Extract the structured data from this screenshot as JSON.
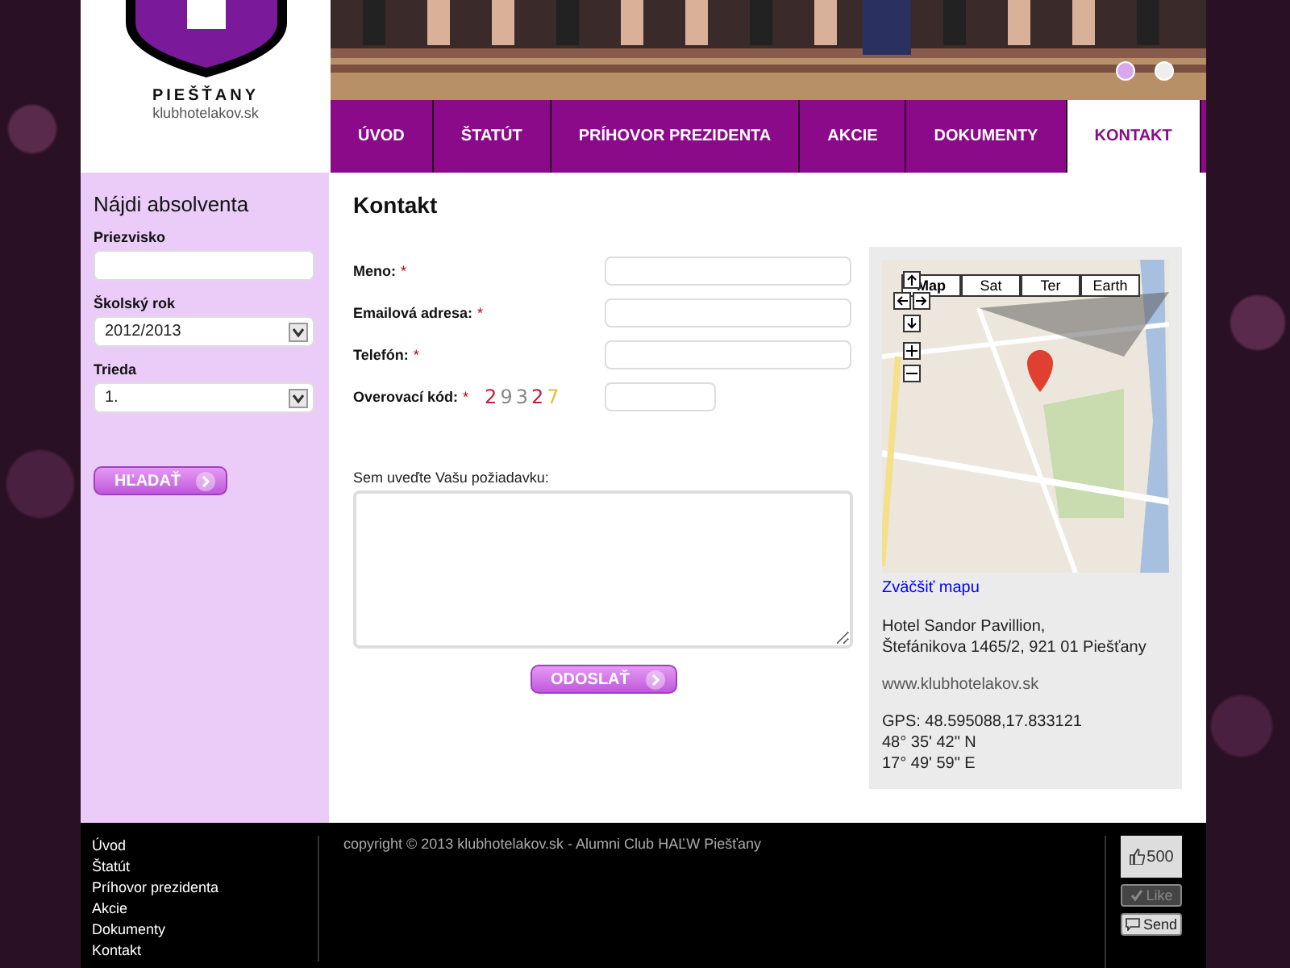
{
  "logo": {
    "city": "PIEŠŤANY",
    "site": "klubhotelakov.sk"
  },
  "banner": {
    "slides": [
      {
        "selected": true
      },
      {
        "selected": false
      }
    ]
  },
  "nav": [
    {
      "label": "ÚVOD",
      "selected": false
    },
    {
      "label": "ŠTATÚT",
      "selected": false
    },
    {
      "label": "PRÍHOVOR PREZIDENTA",
      "selected": false
    },
    {
      "label": "AKCIE",
      "selected": false
    },
    {
      "label": "DOKUMENTY",
      "selected": false
    },
    {
      "label": "KONTAKT",
      "selected": true
    }
  ],
  "sidebar": {
    "title": "Nájdi absolventa",
    "fields": [
      {
        "kind": "input",
        "label": "Priezvisko"
      },
      {
        "kind": "select",
        "label": "Školský rok",
        "value": "2012/2013"
      },
      {
        "kind": "select",
        "label": "Trieda",
        "value": "1."
      }
    ],
    "button": "HĽADAŤ"
  },
  "content": {
    "title": "Kontakt",
    "fields": [
      {
        "label": "Meno:",
        "required": "*",
        "kind": "wide"
      },
      {
        "label": "Emailová adresa:",
        "required": "*",
        "kind": "wide"
      },
      {
        "label": "Telefón:",
        "required": "*",
        "kind": "wide"
      },
      {
        "label": "Overovací kód:",
        "required": "*",
        "kind": "captcha",
        "captcha": "29327"
      }
    ],
    "message_label": "Sem uveďte Vašu požiadavku:",
    "submit": "ODOSLAŤ"
  },
  "map": {
    "map_types": [
      {
        "label": "Map",
        "selected": true
      },
      {
        "label": "Sat",
        "selected": false
      },
      {
        "label": "Ter",
        "selected": false
      },
      {
        "label": "Earth",
        "selected": false
      }
    ],
    "enlarge_link": "Zväčšiť mapu",
    "address": [
      "Hotel Sandor Pavillion,",
      "Štefánikova 1465/2, 921 01 Piešťany"
    ],
    "web": "www.klubhotelakov.sk",
    "gps": [
      "GPS: 48.595088,17.833121",
      "48° 35' 42\" N",
      "17° 49' 59\" E"
    ]
  },
  "footer": {
    "links": [
      "Úvod",
      "Štatút",
      "Príhovor prezidenta",
      "Akcie",
      "Dokumenty",
      "Kontakt"
    ],
    "copyright": "copyright © 2013 klubhotelakov.sk - Alumni Club HAĽW Piešťany",
    "like_count": "500",
    "like": {
      "label": "Like",
      "disabled": true
    },
    "send": "Send"
  }
}
